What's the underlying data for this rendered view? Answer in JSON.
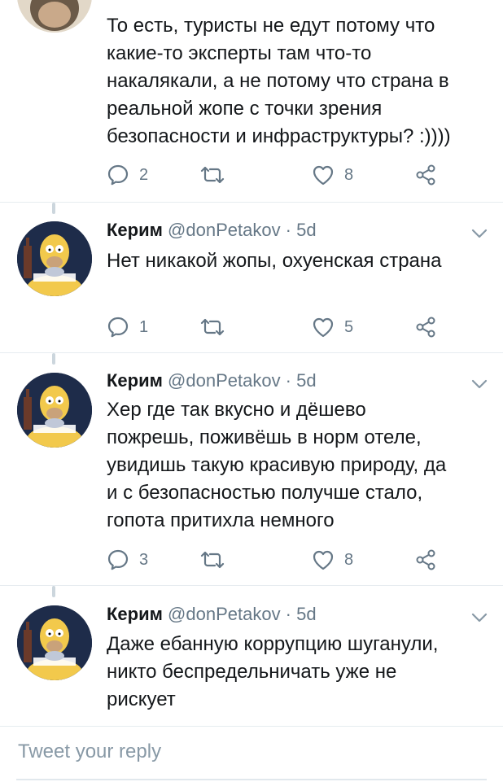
{
  "tweets": [
    {
      "text_lines": [
        "То есть, туристы не едут потому что",
        "какие-то эксперты там что-то",
        "накалякали, а не потому что страна в",
        "реальной жопе с точки зрения",
        "безопасности и инфраструктуры? :))))"
      ],
      "replies": "2",
      "likes": "8"
    },
    {
      "name": "Керим",
      "handle": "@donPetakov",
      "time": "5d",
      "text_lines": [
        "Нет никакой жопы, охуенская страна"
      ],
      "replies": "1",
      "likes": "5"
    },
    {
      "name": "Керим",
      "handle": "@donPetakov",
      "time": "5d",
      "text_lines": [
        "Хер где так вкусно и дёшево",
        "пожрешь, поживёшь в норм отеле,",
        "увидишь такую красивую природу, да",
        "и с безопасностью получше стало,",
        "гопота притихла немного"
      ],
      "replies": "3",
      "likes": "8"
    },
    {
      "name": "Керим",
      "handle": "@donPetakov",
      "time": "5d",
      "text_lines": [
        "Даже ебанную коррупцию шуганули,",
        "никто беспредельничать уже не",
        "рискует"
      ]
    }
  ],
  "meta_separator": " · ",
  "reply_box": {
    "placeholder": "Tweet your reply"
  },
  "colors": {
    "icon": "#657786",
    "text": "#14171a",
    "divider": "#e6ecf0"
  },
  "icons": [
    "reply-icon",
    "retweet-icon",
    "like-icon",
    "share-icon",
    "chevron-down-icon"
  ]
}
